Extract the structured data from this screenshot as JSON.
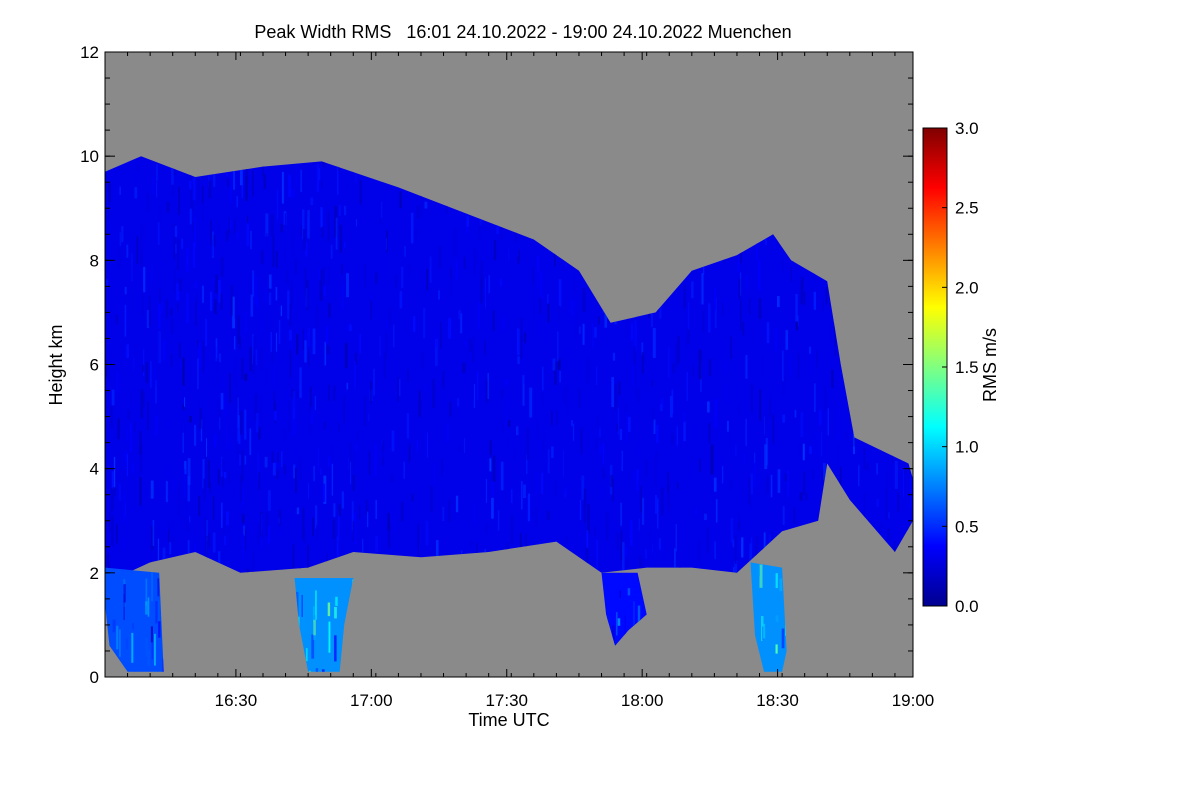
{
  "chart_data": {
    "type": "heatmap",
    "title": "Peak Width RMS   16:01 24.10.2022 - 19:00 24.10.2022 Muenchen",
    "xlabel": "Time UTC",
    "ylabel": "Height km",
    "xlim": [
      "16:01",
      "19:00"
    ],
    "ylim": [
      0,
      12
    ],
    "x_ticks": [
      {
        "value": "16:30",
        "minutes": 29
      },
      {
        "value": "17:00",
        "minutes": 59
      },
      {
        "value": "17:30",
        "minutes": 89
      },
      {
        "value": "18:00",
        "minutes": 119
      },
      {
        "value": "18:30",
        "minutes": 149
      },
      {
        "value": "19:00",
        "minutes": 179
      }
    ],
    "y_ticks": [
      0,
      2,
      4,
      6,
      8,
      10,
      12
    ],
    "background_color": "#8a8a8a",
    "colorbar": {
      "label": "RMS m/s",
      "range": [
        0.0,
        3.0
      ],
      "ticks": [
        "0.0",
        "0.5",
        "1.0",
        "1.5",
        "2.0",
        "2.5",
        "3.0"
      ],
      "colors": [
        "#00008f",
        "#0000ff",
        "#0080ff",
        "#00ffff",
        "#80ff80",
        "#ffff00",
        "#ff8000",
        "#ff0000",
        "#800000"
      ]
    },
    "regions": [
      {
        "name": "main-cloud",
        "typical_rms": 0.3,
        "outline_minutes_km": [
          [
            0,
            3.0
          ],
          [
            0,
            9.7
          ],
          [
            8,
            10.0
          ],
          [
            20,
            9.6
          ],
          [
            35,
            9.8
          ],
          [
            48,
            9.9
          ],
          [
            65,
            9.4
          ],
          [
            80,
            8.9
          ],
          [
            95,
            8.4
          ],
          [
            105,
            7.8
          ],
          [
            112,
            6.8
          ],
          [
            122,
            7.0
          ],
          [
            130,
            7.8
          ],
          [
            140,
            8.1
          ],
          [
            148,
            8.5
          ],
          [
            152,
            8.0
          ],
          [
            160,
            7.6
          ],
          [
            163,
            6.0
          ],
          [
            166,
            4.6
          ],
          [
            178,
            4.1
          ],
          [
            179,
            3.8
          ],
          [
            179,
            3.0
          ],
          [
            175,
            2.4
          ],
          [
            165,
            3.4
          ],
          [
            160,
            4.1
          ],
          [
            158,
            3.0
          ],
          [
            150,
            2.8
          ],
          [
            140,
            2.0
          ],
          [
            130,
            2.1
          ],
          [
            120,
            2.1
          ],
          [
            110,
            2.0
          ],
          [
            100,
            2.6
          ],
          [
            85,
            2.4
          ],
          [
            70,
            2.3
          ],
          [
            55,
            2.4
          ],
          [
            45,
            2.1
          ],
          [
            30,
            2.0
          ],
          [
            20,
            2.4
          ],
          [
            10,
            2.2
          ],
          [
            5,
            2.0
          ],
          [
            0,
            2.0
          ]
        ],
        "texture_strength": 0.3
      },
      {
        "name": "precip-shaft-1",
        "typical_rms": 0.6,
        "outline_minutes_km": [
          [
            0,
            2.1
          ],
          [
            12,
            2.0
          ],
          [
            13,
            0.1
          ],
          [
            5,
            0.1
          ],
          [
            1,
            0.6
          ],
          [
            0,
            1.4
          ]
        ],
        "texture_strength": 0.7
      },
      {
        "name": "precip-shaft-2",
        "typical_rms": 0.8,
        "outline_minutes_km": [
          [
            42,
            1.9
          ],
          [
            55,
            1.9
          ],
          [
            53,
            1.0
          ],
          [
            52,
            0.1
          ],
          [
            45,
            0.1
          ],
          [
            43,
            1.0
          ]
        ],
        "texture_strength": 0.9
      },
      {
        "name": "precip-shaft-3",
        "typical_rms": 0.4,
        "outline_minutes_km": [
          [
            110,
            2.0
          ],
          [
            118,
            2.0
          ],
          [
            120,
            1.2
          ],
          [
            116,
            0.9
          ],
          [
            113,
            0.6
          ],
          [
            111,
            1.2
          ]
        ],
        "texture_strength": 0.6
      },
      {
        "name": "precip-shaft-4",
        "typical_rms": 0.8,
        "outline_minutes_km": [
          [
            143,
            2.2
          ],
          [
            150,
            2.1
          ],
          [
            151,
            0.5
          ],
          [
            150,
            0.1
          ],
          [
            146,
            0.1
          ],
          [
            144,
            0.8
          ]
        ],
        "texture_strength": 0.9
      }
    ]
  }
}
